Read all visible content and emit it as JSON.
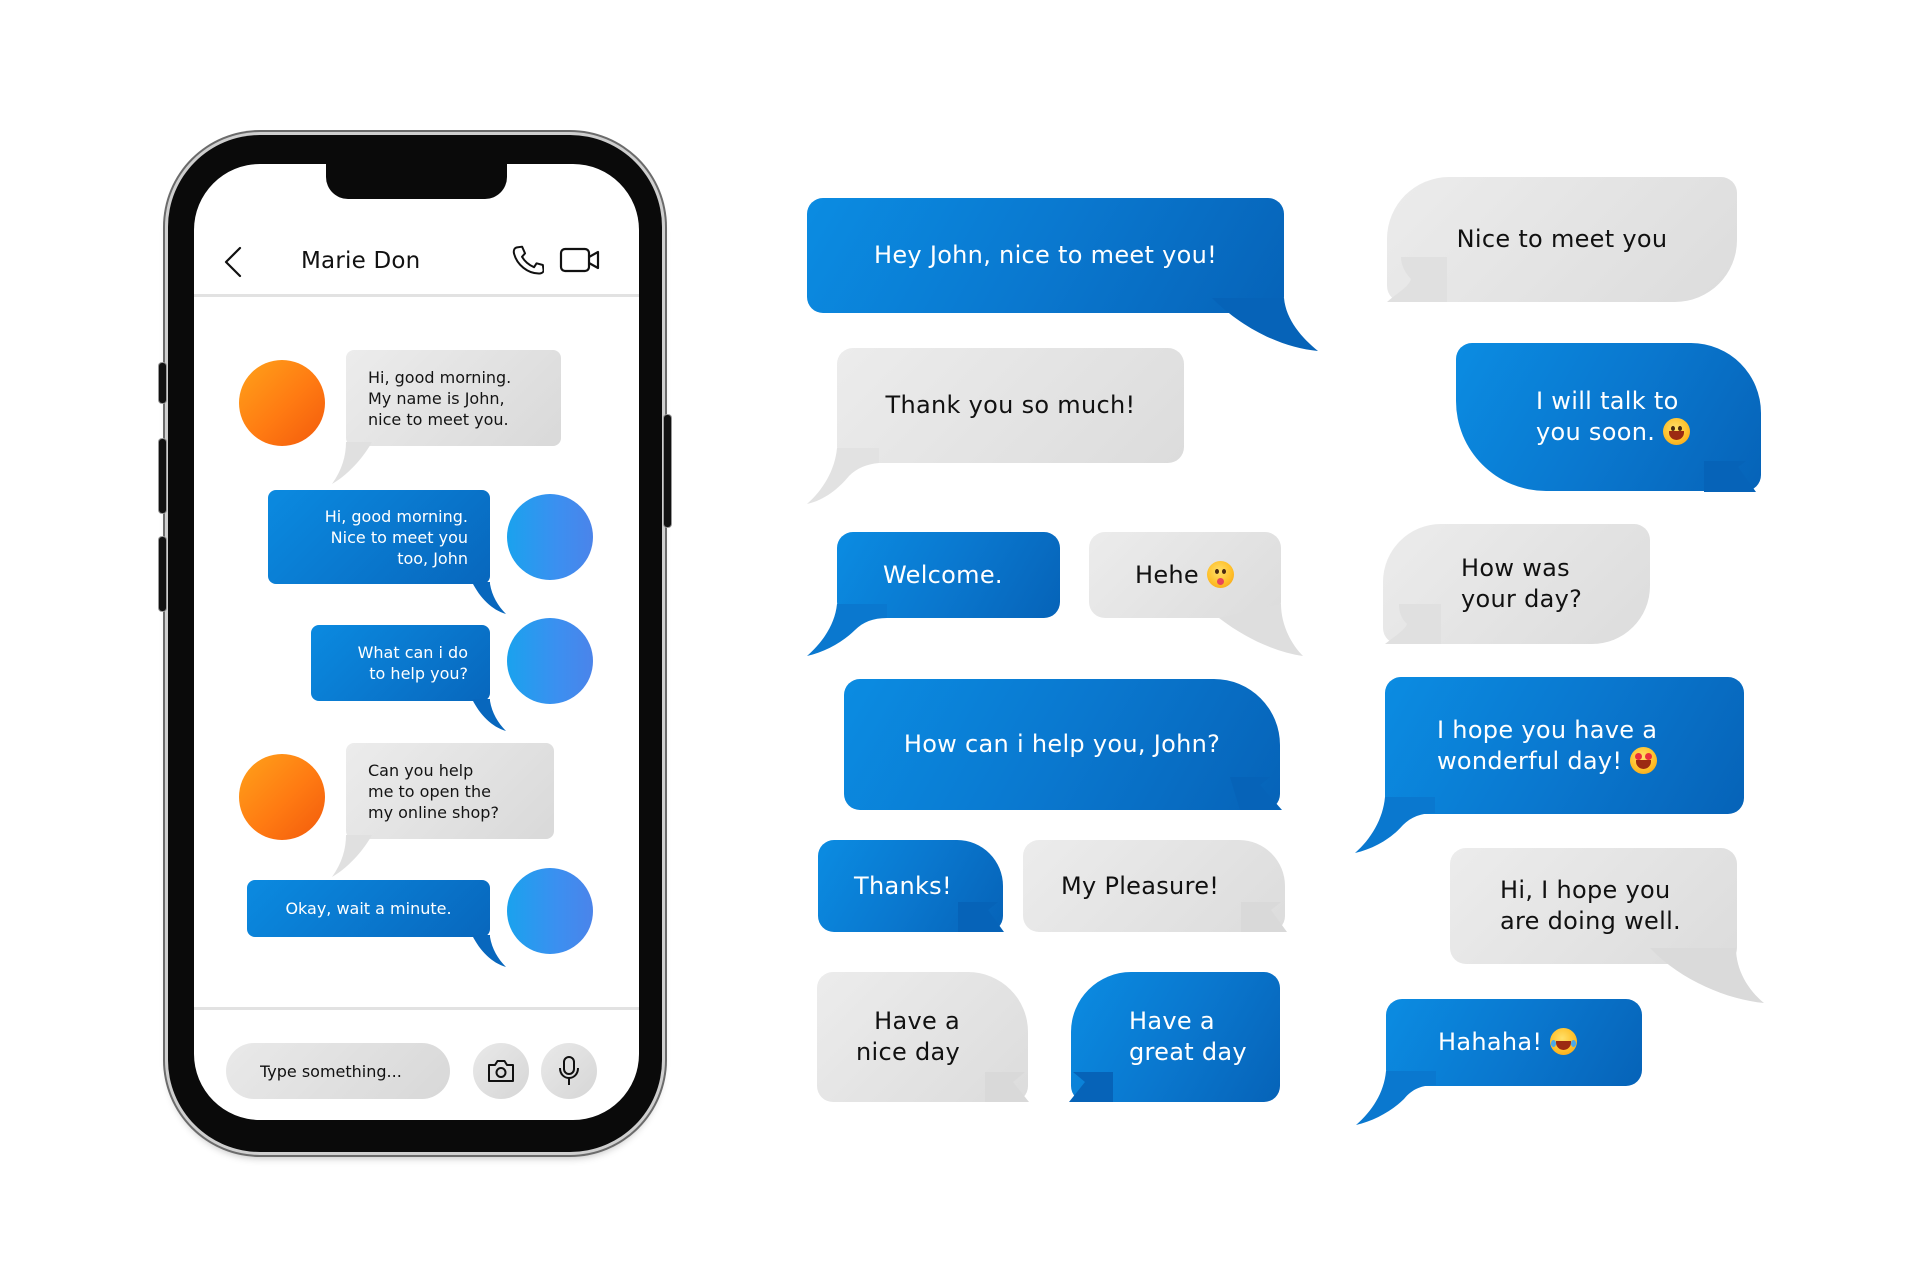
{
  "phone": {
    "header": {
      "contact_name": "Marie Don",
      "back_icon": "chevron-left-icon",
      "call_icon": "phone-icon",
      "video_icon": "video-camera-icon"
    },
    "messages": [
      {
        "sender": "contact",
        "avatar_color": "#ff7a12",
        "lines": [
          "Hi, good morning.",
          "My name is John,",
          "nice to meet you."
        ]
      },
      {
        "sender": "me",
        "avatar_color": "#3c8ff0",
        "lines": [
          "Hi, good morning.",
          "Nice to meet you",
          "too, John"
        ]
      },
      {
        "sender": "me",
        "avatar_color": "#3c8ff0",
        "lines": [
          "What can i do",
          "to help you?"
        ]
      },
      {
        "sender": "contact",
        "avatar_color": "#ff7a12",
        "lines": [
          "Can you help",
          "me to open the",
          "my online shop?"
        ]
      },
      {
        "sender": "me",
        "avatar_color": "#3c8ff0",
        "lines": [
          "Okay, wait a minute."
        ]
      }
    ],
    "composer": {
      "placeholder": "Type something...",
      "camera_icon": "camera-icon",
      "mic_icon": "microphone-icon"
    }
  },
  "bubbles": [
    {
      "id": "hey-john",
      "style": "blue",
      "lines": [
        "Hey John, nice to meet you!"
      ],
      "emoji": null
    },
    {
      "id": "thank-you-so-much",
      "style": "gray",
      "lines": [
        "Thank you so much!"
      ],
      "emoji": null
    },
    {
      "id": "welcome",
      "style": "blue",
      "lines": [
        "Welcome."
      ],
      "emoji": null
    },
    {
      "id": "hehe",
      "style": "gray",
      "lines": [
        "Hehe"
      ],
      "emoji": "tongue-out-emoji"
    },
    {
      "id": "how-can-i-help",
      "style": "blue",
      "lines": [
        "How can i help you, John?"
      ],
      "emoji": null
    },
    {
      "id": "thanks",
      "style": "blue",
      "lines": [
        "Thanks!"
      ],
      "emoji": null
    },
    {
      "id": "my-pleasure",
      "style": "gray",
      "lines": [
        "My Pleasure!"
      ],
      "emoji": null
    },
    {
      "id": "have-a-nice-day",
      "style": "gray",
      "lines": [
        "Have a",
        "nice day"
      ],
      "emoji": null
    },
    {
      "id": "have-a-great-day",
      "style": "blue",
      "lines": [
        "Have a",
        "great day"
      ],
      "emoji": null
    },
    {
      "id": "nice-to-meet-you",
      "style": "gray",
      "lines": [
        "Nice to meet you"
      ],
      "emoji": null
    },
    {
      "id": "talk-to-you-soon",
      "style": "blue",
      "lines": [
        "I will talk to",
        "you soon."
      ],
      "emoji": "grinning-emoji"
    },
    {
      "id": "how-was-your-day",
      "style": "gray",
      "lines": [
        "How was",
        "your day?"
      ],
      "emoji": null
    },
    {
      "id": "wonderful-day",
      "style": "blue",
      "lines": [
        "I hope you have a",
        "wonderful day!"
      ],
      "emoji": "heart-eyes-emoji"
    },
    {
      "id": "doing-well",
      "style": "gray",
      "lines": [
        "Hi, I hope you",
        "are doing well."
      ],
      "emoji": null
    },
    {
      "id": "hahaha",
      "style": "blue",
      "lines": [
        "Hahaha!"
      ],
      "emoji": "tears-of-joy-emoji"
    }
  ],
  "colors": {
    "bubble_blue": "#0a78cf",
    "bubble_gray": "#e2e2e2",
    "avatar_orange": "#ff7a12",
    "avatar_blue": "#3c8ff0",
    "phone_frame": "#0a0a0a"
  }
}
